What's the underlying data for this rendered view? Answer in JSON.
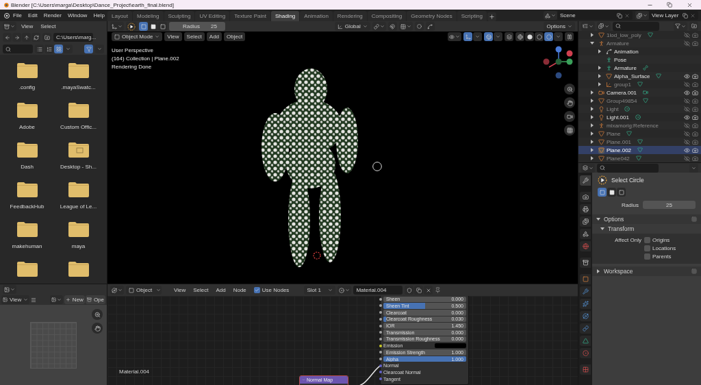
{
  "window": {
    "title": "Blender [C:\\Users\\marga\\Desktop\\Dance_Project\\earth_final.blend]"
  },
  "menu": [
    "File",
    "Edit",
    "Render",
    "Window",
    "Help"
  ],
  "workspaces": [
    {
      "label": "Layout",
      "selected": false
    },
    {
      "label": "Modeling",
      "selected": false
    },
    {
      "label": "Sculpting",
      "selected": false
    },
    {
      "label": "UV Editing",
      "selected": false
    },
    {
      "label": "Texture Paint",
      "selected": false
    },
    {
      "label": "Shading",
      "selected": true
    },
    {
      "label": "Animation",
      "selected": false
    },
    {
      "label": "Rendering",
      "selected": false
    },
    {
      "label": "Compositing",
      "selected": false
    },
    {
      "label": "Geometry Nodes",
      "selected": false
    },
    {
      "label": "Scripting",
      "selected": false
    }
  ],
  "scene": "Scene",
  "view_layer": "View Layer",
  "file_browser": {
    "menu": [
      "View",
      "Select"
    ],
    "path": "C:\\Users\\marg...",
    "display_modes": [
      {
        "selected": false
      },
      {
        "selected": false
      },
      {
        "selected": true
      }
    ],
    "filter_on": true,
    "folders": [
      {
        "name": ".config",
        "shortcut": false
      },
      {
        "name": ".mayaSwatc...",
        "shortcut": false
      },
      {
        "name": "Adobe",
        "shortcut": false
      },
      {
        "name": "Custom Offic...",
        "shortcut": false
      },
      {
        "name": "Dash",
        "shortcut": false
      },
      {
        "name": "Desktop - Sh...",
        "shortcut": true
      },
      {
        "name": "FeedbackHub",
        "shortcut": false
      },
      {
        "name": "League of Le...",
        "shortcut": false
      },
      {
        "name": "makehuman",
        "shortcut": false
      },
      {
        "name": "maya",
        "shortcut": false
      },
      {
        "shortcut": false
      },
      {
        "shortcut": false
      }
    ]
  },
  "image_editor": {
    "view": "View",
    "new": "New",
    "open": "Ope"
  },
  "viewport": {
    "radius_label": "Radius",
    "radius": "25",
    "orientation": "Global",
    "options": "Options",
    "select_modes": [
      {
        "selected": true
      },
      {
        "selected": false
      },
      {
        "selected": false
      }
    ],
    "mode": "Object Mode",
    "menu": [
      "View",
      "Select",
      "Add",
      "Object"
    ],
    "overlay_lines": [
      "User Perspective",
      "(164) Collection | Plane.002",
      "Rendering Done"
    ],
    "gizmos_on": true,
    "overlays_on": true,
    "shading_modes": [
      {
        "selected": false
      },
      {
        "selected": false
      },
      {
        "selected": false
      },
      {
        "selected": true
      }
    ]
  },
  "node_editor": {
    "object_type": "Object",
    "menu": [
      "View",
      "Select",
      "Add",
      "Node"
    ],
    "use_nodes": {
      "label": "Use Nodes",
      "checked": true
    },
    "slot": "Slot 1",
    "material": "Material.004",
    "frame_label": "Material.004",
    "rows": [
      {
        "kind": "number",
        "label": "Sheen",
        "value": "0.000"
      },
      {
        "kind": "slider",
        "label": "Sheen Tint",
        "value": "0.500",
        "level": 0.5
      },
      {
        "kind": "number",
        "label": "Clearcoat",
        "value": "0.000"
      },
      {
        "kind": "slider",
        "label": "Clearcoat Roughness",
        "value": "0.030",
        "level": 0.03
      },
      {
        "kind": "number",
        "label": "IOR",
        "value": "1.450"
      },
      {
        "kind": "number",
        "label": "Transmission",
        "value": "0.000"
      },
      {
        "kind": "number",
        "label": "Transmission Roughness",
        "value": "0.000"
      },
      {
        "kind": "color",
        "label": "Emission",
        "color": "#000000"
      },
      {
        "kind": "number",
        "label": "Emission Strength",
        "value": "1.000"
      },
      {
        "kind": "slider",
        "label": "Alpha",
        "value": "1.000",
        "level": 1
      },
      {
        "kind": "vector",
        "label": "Normal"
      },
      {
        "kind": "vector",
        "label": "Clearcoat Normal"
      },
      {
        "kind": "vector",
        "label": "Tangent"
      }
    ],
    "normal_map": {
      "title": "Normal Map"
    }
  },
  "outliner": {
    "items": [
      {
        "name": "1lod_low_poly",
        "kind": "mesh",
        "visible": false,
        "expanded": false,
        "selected": false
      },
      {
        "name": "Armature",
        "kind": "armature",
        "visible": false,
        "expanded": true,
        "selected": false,
        "children": [
          {
            "name": "Animation",
            "kind": "action",
            "expanded": false,
            "selected": false
          },
          {
            "name": "Pose",
            "kind": "pose",
            "selected": false
          },
          {
            "name": "Armature",
            "kind": "bone",
            "expanded": false,
            "selected": false
          },
          {
            "name": "Alpha_Surface",
            "kind": "mesh",
            "visible": true,
            "expanded": false,
            "selected": false
          },
          {
            "name": "group1",
            "kind": "empty",
            "visible": false,
            "expanded": false,
            "selected": false
          }
        ]
      },
      {
        "name": "Camera.001",
        "kind": "camera",
        "visible": true,
        "expanded": false,
        "selected": false
      },
      {
        "name": "Group49854",
        "kind": "mesh",
        "visible": false,
        "expanded": false,
        "selected": false
      },
      {
        "name": "Light",
        "kind": "light",
        "visible": false,
        "expanded": false,
        "selected": false
      },
      {
        "name": "Light.001",
        "kind": "light",
        "visible": true,
        "expanded": false,
        "selected": false
      },
      {
        "name": "mixamorig:Reference",
        "kind": "armature",
        "visible": false,
        "expanded": false,
        "selected": false
      },
      {
        "name": "Plane",
        "kind": "mesh",
        "visible": false,
        "expanded": false,
        "selected": false
      },
      {
        "name": "Plane.001",
        "kind": "mesh",
        "visible": false,
        "expanded": false,
        "selected": false
      },
      {
        "name": "Plane.002",
        "kind": "mesh",
        "visible": true,
        "expanded": false,
        "selected": true
      },
      {
        "name": "Plane042",
        "kind": "mesh",
        "visible": false,
        "expanded": false,
        "selected": false
      }
    ]
  },
  "properties": {
    "tabs": [
      {
        "kind": "tool",
        "selected": true
      },
      {
        "kind": "render",
        "selected": false
      },
      {
        "kind": "output",
        "selected": false
      },
      {
        "kind": "view_layer",
        "selected": false
      },
      {
        "kind": "scene",
        "selected": false
      },
      {
        "kind": "world",
        "selected": false
      },
      {
        "kind": "collection",
        "selected": false
      },
      {
        "kind": "object",
        "selected": false
      },
      {
        "kind": "modifiers",
        "selected": false
      },
      {
        "kind": "particles",
        "selected": false
      },
      {
        "kind": "physics",
        "selected": false
      },
      {
        "kind": "constraints",
        "selected": false
      },
      {
        "kind": "data",
        "selected": false
      },
      {
        "kind": "material",
        "selected": false
      },
      {
        "kind": "texture",
        "selected": false
      }
    ],
    "tool": "Select Circle",
    "select_modes": [
      {
        "selected": true
      },
      {
        "selected": false
      },
      {
        "selected": false
      }
    ],
    "radius_label": "Radius",
    "radius": "25",
    "panels": [
      {
        "title": "Options",
        "expanded": true,
        "subpanels": [
          {
            "title": "Transform",
            "expanded": true,
            "field_label": "Affect Only",
            "options": [
              {
                "label": "Origins",
                "checked": false
              },
              {
                "label": "Locations",
                "checked": false
              },
              {
                "label": "Parents",
                "checked": false
              }
            ]
          }
        ]
      },
      {
        "title": "Workspace",
        "expanded": false
      }
    ]
  }
}
